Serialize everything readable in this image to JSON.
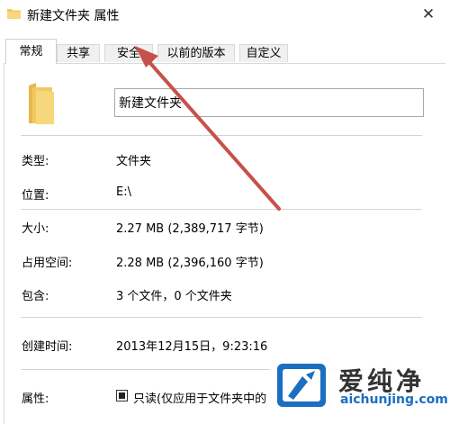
{
  "window": {
    "title": "新建文件夹 属性",
    "close_glyph": "✕"
  },
  "tabs": [
    {
      "label": "常规",
      "active": true
    },
    {
      "label": "共享",
      "active": false
    },
    {
      "label": "安全",
      "active": false
    },
    {
      "label": "以前的版本",
      "active": false
    },
    {
      "label": "自定义",
      "active": false
    }
  ],
  "general": {
    "folder_name": "新建文件夹",
    "rows": [
      {
        "label": "类型:",
        "value": "文件夹"
      },
      {
        "label": "位置:",
        "value": "E:\\"
      },
      {
        "label": "大小:",
        "value": "2.27 MB (2,389,717 字节)"
      },
      {
        "label": "占用空间:",
        "value": "2.28 MB (2,396,160 字节)"
      },
      {
        "label": "包含:",
        "value": "3 个文件，0 个文件夹"
      },
      {
        "label": "创建时间:",
        "value": "2013年12月15日，9:23:16"
      }
    ],
    "attributes_label": "属性:",
    "readonly_label": "只读(仅应用于文件夹中的"
  },
  "watermark": {
    "name": "爱纯净",
    "url": "aichunjing.com"
  },
  "colors": {
    "folder_yellow": "#f2c95f",
    "arrow_red": "#c8504a",
    "watermark_blue": "#1a6fc0"
  },
  "icons": {
    "title": "folder-icon",
    "large": "folder-icon",
    "close": "close-icon"
  }
}
